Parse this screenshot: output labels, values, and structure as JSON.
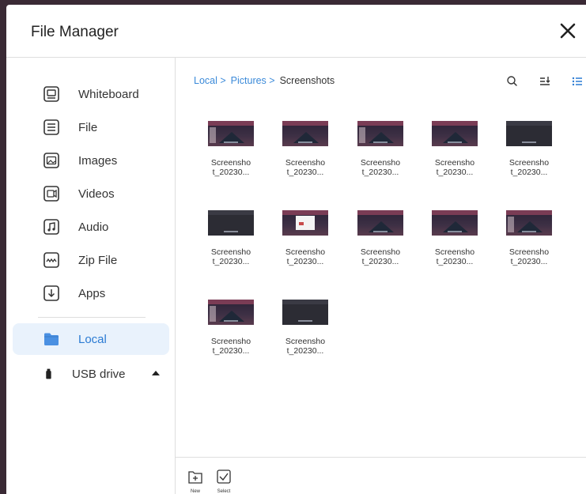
{
  "window": {
    "title": "File Manager"
  },
  "sidebar": {
    "items": [
      {
        "label": "Whiteboard",
        "icon": "whiteboard-icon"
      },
      {
        "label": "File",
        "icon": "file-icon"
      },
      {
        "label": "Images",
        "icon": "image-icon"
      },
      {
        "label": "Videos",
        "icon": "video-icon"
      },
      {
        "label": "Audio",
        "icon": "audio-icon"
      },
      {
        "label": "Zip File",
        "icon": "zip-file-icon"
      },
      {
        "label": "Apps",
        "icon": "apps-download-icon"
      }
    ],
    "local": {
      "label": "Local",
      "icon": "folder-icon",
      "selected": true
    },
    "usb": {
      "label": "USB drive",
      "icon": "usb-drive-icon",
      "expanded": false
    }
  },
  "breadcrumb": {
    "items": [
      "Local >",
      "Pictures >",
      "Screenshots"
    ]
  },
  "toolbar": {
    "search": "search-icon",
    "sort": "sort-icon",
    "view": "list-view-icon"
  },
  "files": [
    {
      "name_line1": "Screensho",
      "name_line2": "t_20230..."
    },
    {
      "name_line1": "Screensho",
      "name_line2": "t_20230..."
    },
    {
      "name_line1": "Screensho",
      "name_line2": "t_20230..."
    },
    {
      "name_line1": "Screensho",
      "name_line2": "t_20230..."
    },
    {
      "name_line1": "Screensho",
      "name_line2": "t_20230..."
    },
    {
      "name_line1": "Screensho",
      "name_line2": "t_20230..."
    },
    {
      "name_line1": "Screensho",
      "name_line2": "t_20230..."
    },
    {
      "name_line1": "Screensho",
      "name_line2": "t_20230..."
    },
    {
      "name_line1": "Screensho",
      "name_line2": "t_20230..."
    },
    {
      "name_line1": "Screensho",
      "name_line2": "t_20230..."
    },
    {
      "name_line1": "Screensho",
      "name_line2": "t_20230..."
    },
    {
      "name_line1": "Screensho",
      "name_line2": "t_20230..."
    }
  ],
  "bottombar": {
    "new_label": "New",
    "select_label": "Select"
  },
  "colors": {
    "accent": "#3b8ad9",
    "selected_bg": "#e9f2fc",
    "divider": "#dedede"
  }
}
